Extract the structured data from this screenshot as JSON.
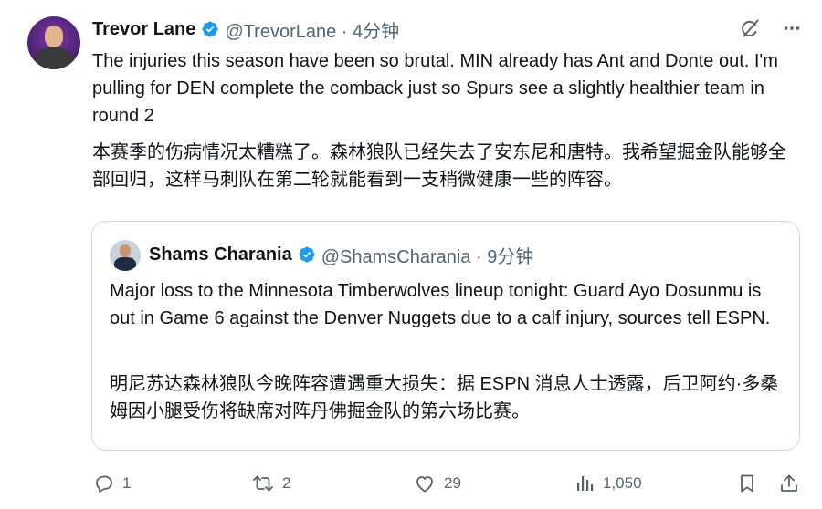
{
  "tweet": {
    "author_name": "Trevor Lane",
    "handle_time": "@TrevorLane · 4分钟",
    "text_en": "The injuries this season have been so brutal. MIN already has Ant and Donte out. I'm pulling for DEN complete the comback just so Spurs see a slightly healthier team in round 2",
    "text_zh": "本赛季的伤病情况太糟糕了。森林狼队已经失去了安东尼和唐特。我希望掘金队能够全部回归，这样马刺队在第二轮就能看到一支稍微健康一些的阵容。"
  },
  "quoted": {
    "author_name": "Shams Charania",
    "handle_time": "@ShamsCharania · 9分钟",
    "text_en": "Major loss to the Minnesota Timberwolves lineup tonight: Guard Ayo Dosunmu is out in Game 6 against the Denver Nuggets due to a calf injury, sources tell ESPN.",
    "text_zh": "明尼苏达森林狼队今晚阵容遭遇重大损失：据 ESPN 消息人士透露，后卫阿约·多桑姆因小腿受伤将缺席对阵丹佛掘金队的第六场比赛。"
  },
  "actions": {
    "replies": "1",
    "reposts": "2",
    "likes": "29",
    "views": "1,050"
  },
  "colors": {
    "verified": "#1d9bf0",
    "text": "#0f1419",
    "secondary": "#536471",
    "border": "#cfd9de"
  },
  "icons": [
    "verified-badge-icon",
    "grok-icon",
    "more-icon",
    "reply-icon",
    "repost-icon",
    "like-icon",
    "views-icon",
    "bookmark-icon",
    "share-icon"
  ]
}
